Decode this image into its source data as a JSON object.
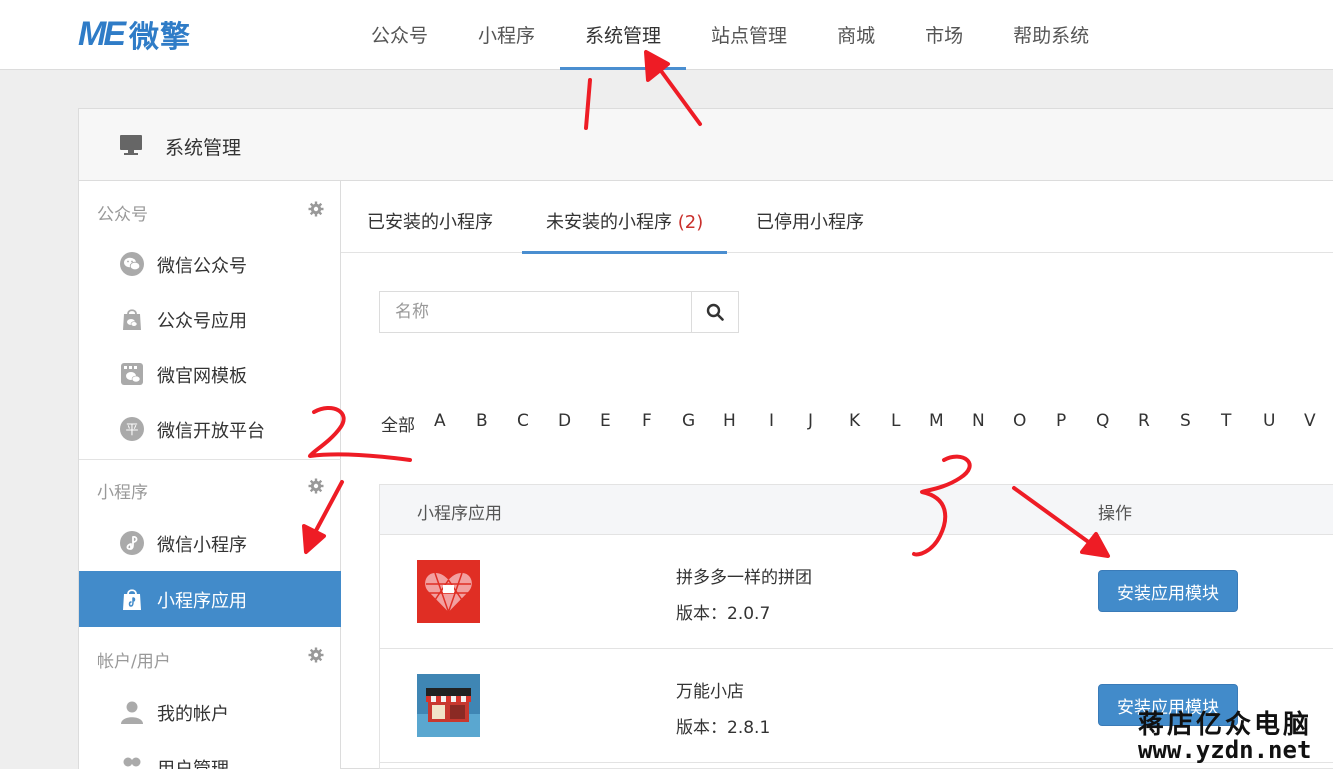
{
  "logo": {
    "mark": "ME",
    "name": "微擎"
  },
  "topnav": [
    "公众号",
    "小程序",
    "系统管理",
    "站点管理",
    "商城",
    "市场",
    "帮助系统"
  ],
  "panel": {
    "title": "系统管理"
  },
  "sidebar": {
    "groups": [
      {
        "title": "公众号",
        "items": [
          "微信公众号",
          "公众号应用",
          "微官网模板",
          "微信开放平台"
        ]
      },
      {
        "title": "小程序",
        "items": [
          "微信小程序",
          "小程序应用"
        ]
      },
      {
        "title": "帐户/用户",
        "items": [
          "我的帐户",
          "用户管理"
        ]
      }
    ],
    "active_item": "小程序应用"
  },
  "tabs": {
    "installed": "已安装的小程序",
    "uninstalled": "未安装的小程序",
    "uninstalled_count": "(2)",
    "disabled": "已停用小程序",
    "active": "未安装的小程序"
  },
  "search": {
    "placeholder": "名称"
  },
  "letters": [
    "全部",
    "A",
    "B",
    "C",
    "D",
    "E",
    "F",
    "G",
    "H",
    "I",
    "J",
    "K",
    "L",
    "M",
    "N",
    "O",
    "P",
    "Q",
    "R",
    "S",
    "T",
    "U",
    "V"
  ],
  "table": {
    "headers": {
      "app": "小程序应用",
      "action": "操作"
    },
    "rows": [
      {
        "name": "拼多多一样的拼团",
        "version": "版本：2.0.7",
        "button": "安装应用模块"
      },
      {
        "name": "万能小店",
        "version": "版本：2.8.1",
        "button": "安装应用模块"
      }
    ]
  },
  "annotations": [
    "1",
    "2",
    "3"
  ],
  "watermark": {
    "name": "蒋店亿众电脑",
    "url": "www.yzdn.net"
  },
  "colors": {
    "accent": "#428bca",
    "annotation": "#ee1c25",
    "count": "#c9302c"
  }
}
